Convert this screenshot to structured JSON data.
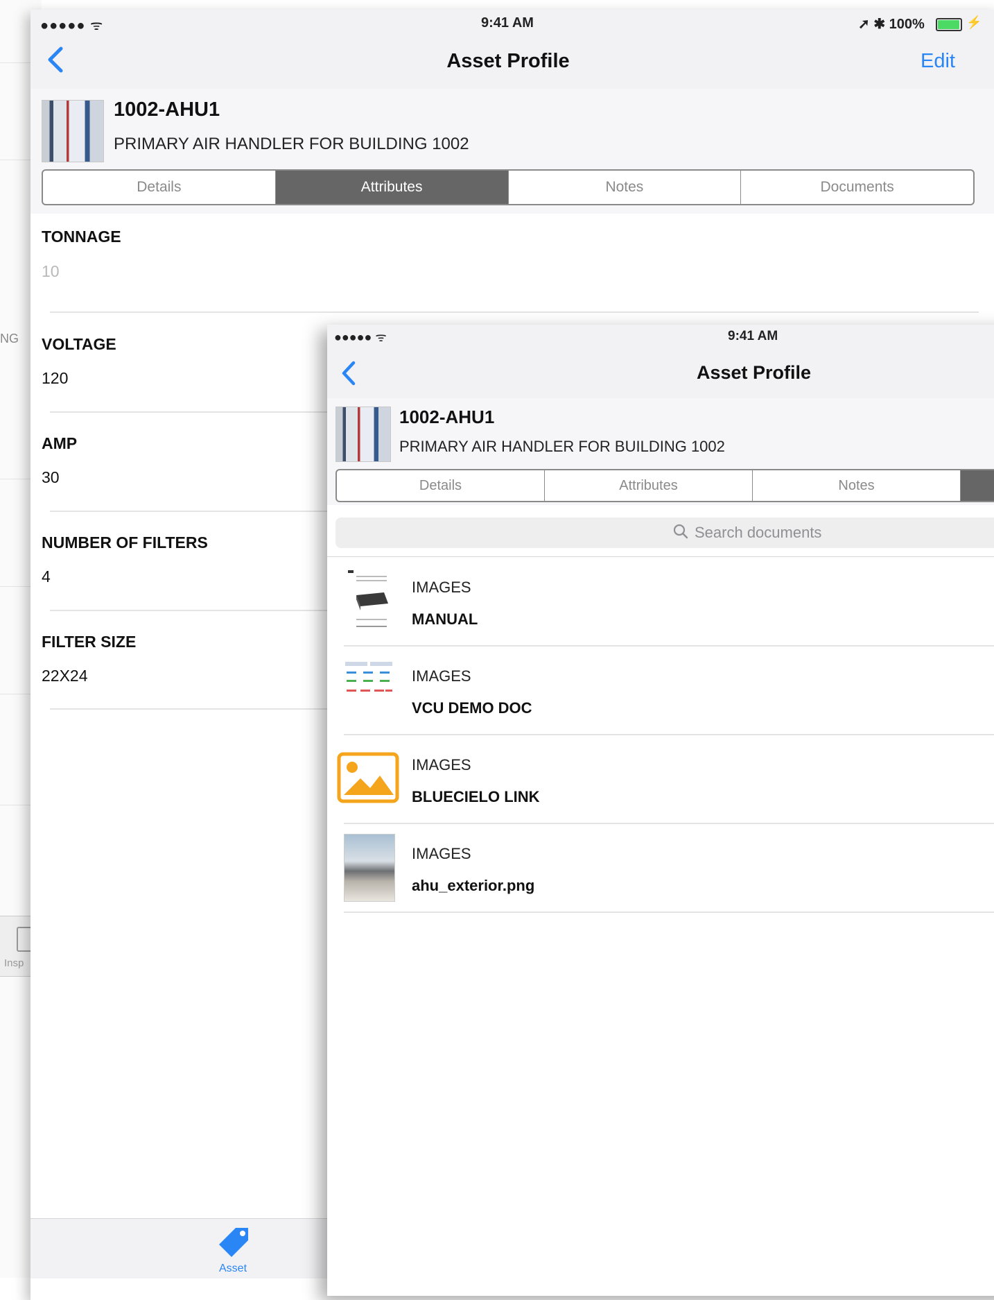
{
  "background": {
    "ng_fragment": "NG",
    "tab_label": "Insp"
  },
  "screen1": {
    "status": {
      "signal": "●●●●● ᯤ",
      "time": "9:41 AM",
      "right": "➚ ✱ 100%"
    },
    "nav": {
      "title": "Asset Profile",
      "edit_label": "Edit"
    },
    "asset": {
      "id": "1002-AHU1",
      "description": "PRIMARY AIR HANDLER FOR BUILDING 1002"
    },
    "tabs": [
      "Details",
      "Attributes",
      "Notes",
      "Documents"
    ],
    "active_tab": "Attributes",
    "attributes": [
      {
        "label": "TONNAGE",
        "value": "10"
      },
      {
        "label": "VOLTAGE",
        "value": "120"
      },
      {
        "label": "AMP",
        "value": "30"
      },
      {
        "label": "NUMBER OF FILTERS",
        "value": "4"
      },
      {
        "label": "FILTER SIZE",
        "value": "22X24"
      }
    ],
    "tabbar": {
      "asset_label": "Asset"
    }
  },
  "screen2": {
    "status": {
      "signal": "●●●●● ᯤ",
      "time": "9:41 AM"
    },
    "nav": {
      "title": "Asset Profile"
    },
    "asset": {
      "id": "1002-AHU1",
      "description": "PRIMARY AIR HANDLER FOR BUILDING 1002"
    },
    "tabs": [
      "Details",
      "Attributes",
      "Notes"
    ],
    "search": {
      "placeholder": "Search documents"
    },
    "documents": [
      {
        "category": "IMAGES",
        "name": "MANUAL"
      },
      {
        "category": "IMAGES",
        "name": "VCU DEMO DOC"
      },
      {
        "category": "IMAGES",
        "name": "BLUECIELO LINK"
      },
      {
        "category": "IMAGES",
        "name": "ahu_exterior.png"
      }
    ]
  },
  "colors": {
    "accent": "#2a85f5",
    "segment_active": "#666666",
    "image_icon": "#f5a51b",
    "battery": "#4cd964"
  }
}
